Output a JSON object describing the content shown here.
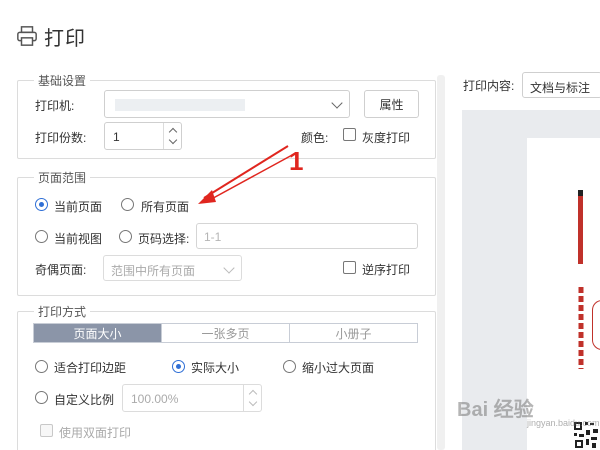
{
  "title": "打印",
  "basic": {
    "legend": "基础设置",
    "printer_label": "打印机:",
    "properties_button": "属性",
    "copies_label": "打印份数:",
    "copies_value": "1",
    "color_label": "颜色:",
    "grayscale_label": "灰度打印"
  },
  "range": {
    "legend": "页面范围",
    "current_page": "当前页面",
    "all_pages": "所有页面",
    "current_view": "当前视图",
    "page_select": "页码选择:",
    "page_select_placeholder": "1-1",
    "odd_even_label": "奇偶页面:",
    "odd_even_value": "范围中所有页面",
    "reverse_label": "逆序打印"
  },
  "method": {
    "legend": "打印方式",
    "tabs": [
      "页面大小",
      "一张多页",
      "小册子"
    ],
    "fit_margins": "适合打印边距",
    "actual_size": "实际大小",
    "shrink_large": "缩小过大页面",
    "custom_scale": "自定义比例",
    "custom_scale_value": "100.00%",
    "duplex": "使用双面打印"
  },
  "preview": {
    "content_label": "打印内容:",
    "content_value": "文档与标注"
  },
  "annotation": {
    "number": "1"
  },
  "watermark": {
    "logo_text": "Bai 经验",
    "sub_text": "jingyan.baidu.com"
  },
  "colors": {
    "accent": "#2f6fd6",
    "annotation_red": "#e0261f",
    "active_tab": "#8b95a8"
  }
}
